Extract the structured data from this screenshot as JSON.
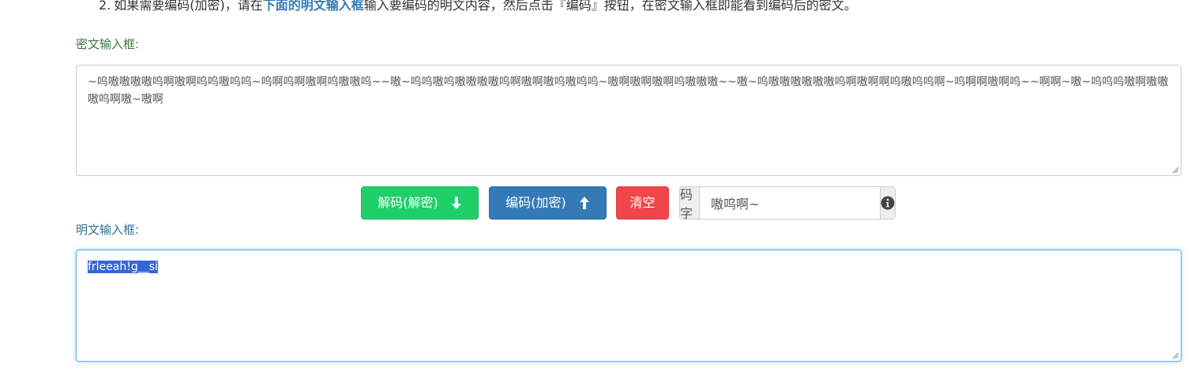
{
  "instruction": {
    "number": "2.",
    "text_before": "如果需要编码(加密)，请在",
    "highlight": "下面的明文输入框",
    "text_after": "输入要编码的明文内容，然后点击『编码』按钮，在密文输入框即能看到编码后的密文。"
  },
  "cipher": {
    "label": "密文输入框:",
    "value": "~呜嗷嗷嗷嗷呜啊嗷啊呜呜嗷呜呜~呜啊呜啊嗷啊呜嗷嗷呜~~嗷~呜呜嗷呜嗷嗷嗷嗷呜啊嗷啊嗷呜嗷呜呜~嗷啊嗷啊嗷啊呜嗷嗷嗷~~嗷~呜嗷嗷嗷嗷嗷嗷呜啊嗷啊啊呜嗷呜呜啊~呜啊啊嗷啊呜~~啊啊~嗷~呜呜呜嗷啊嗷嗷嗷呜啊嗷~嗷啊"
  },
  "buttons": {
    "decode_label": "解码(解密)",
    "encode_label": "编码(加密)",
    "clear_label": "清空"
  },
  "charset": {
    "label": "编码字符",
    "value": "嗷呜啊~"
  },
  "plain": {
    "label": "明文输入框:",
    "value": "frleeah!g__si"
  },
  "icons": {
    "decode": "arrow-down-icon",
    "encode": "arrow-up-icon",
    "info": "info-circle-icon"
  },
  "colors": {
    "decode_button": "#1ecf6a",
    "encode_button": "#337ab7",
    "clear_button": "#f0464b",
    "cipher_label": "#3c763d",
    "plain_label": "#31708f",
    "highlight": "#337ab7"
  }
}
